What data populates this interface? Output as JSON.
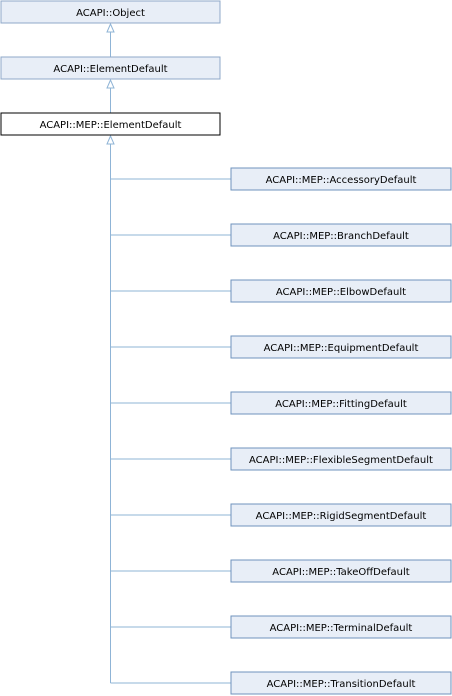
{
  "colors": {
    "edge": "#8fb4d6",
    "ancestor_fill": "#e8eef7",
    "ancestor_stroke": "#8fa8c8",
    "current_fill": "#ffffff",
    "current_stroke": "#000000",
    "child_fill": "#e8eef7",
    "child_stroke": "#6f93bd"
  },
  "ancestors": [
    {
      "label": "ACAPI::Object"
    },
    {
      "label": "ACAPI::ElementDefault"
    }
  ],
  "current": {
    "label": "ACAPI::MEP::ElementDefault"
  },
  "children": [
    {
      "label": "ACAPI::MEP::AccessoryDefault"
    },
    {
      "label": "ACAPI::MEP::BranchDefault"
    },
    {
      "label": "ACAPI::MEP::ElbowDefault"
    },
    {
      "label": "ACAPI::MEP::EquipmentDefault"
    },
    {
      "label": "ACAPI::MEP::FittingDefault"
    },
    {
      "label": "ACAPI::MEP::FlexibleSegmentDefault"
    },
    {
      "label": "ACAPI::MEP::RigidSegmentDefault"
    },
    {
      "label": "ACAPI::MEP::TakeOffDefault"
    },
    {
      "label": "ACAPI::MEP::TerminalDefault"
    },
    {
      "label": "ACAPI::MEP::TransitionDefault"
    }
  ]
}
